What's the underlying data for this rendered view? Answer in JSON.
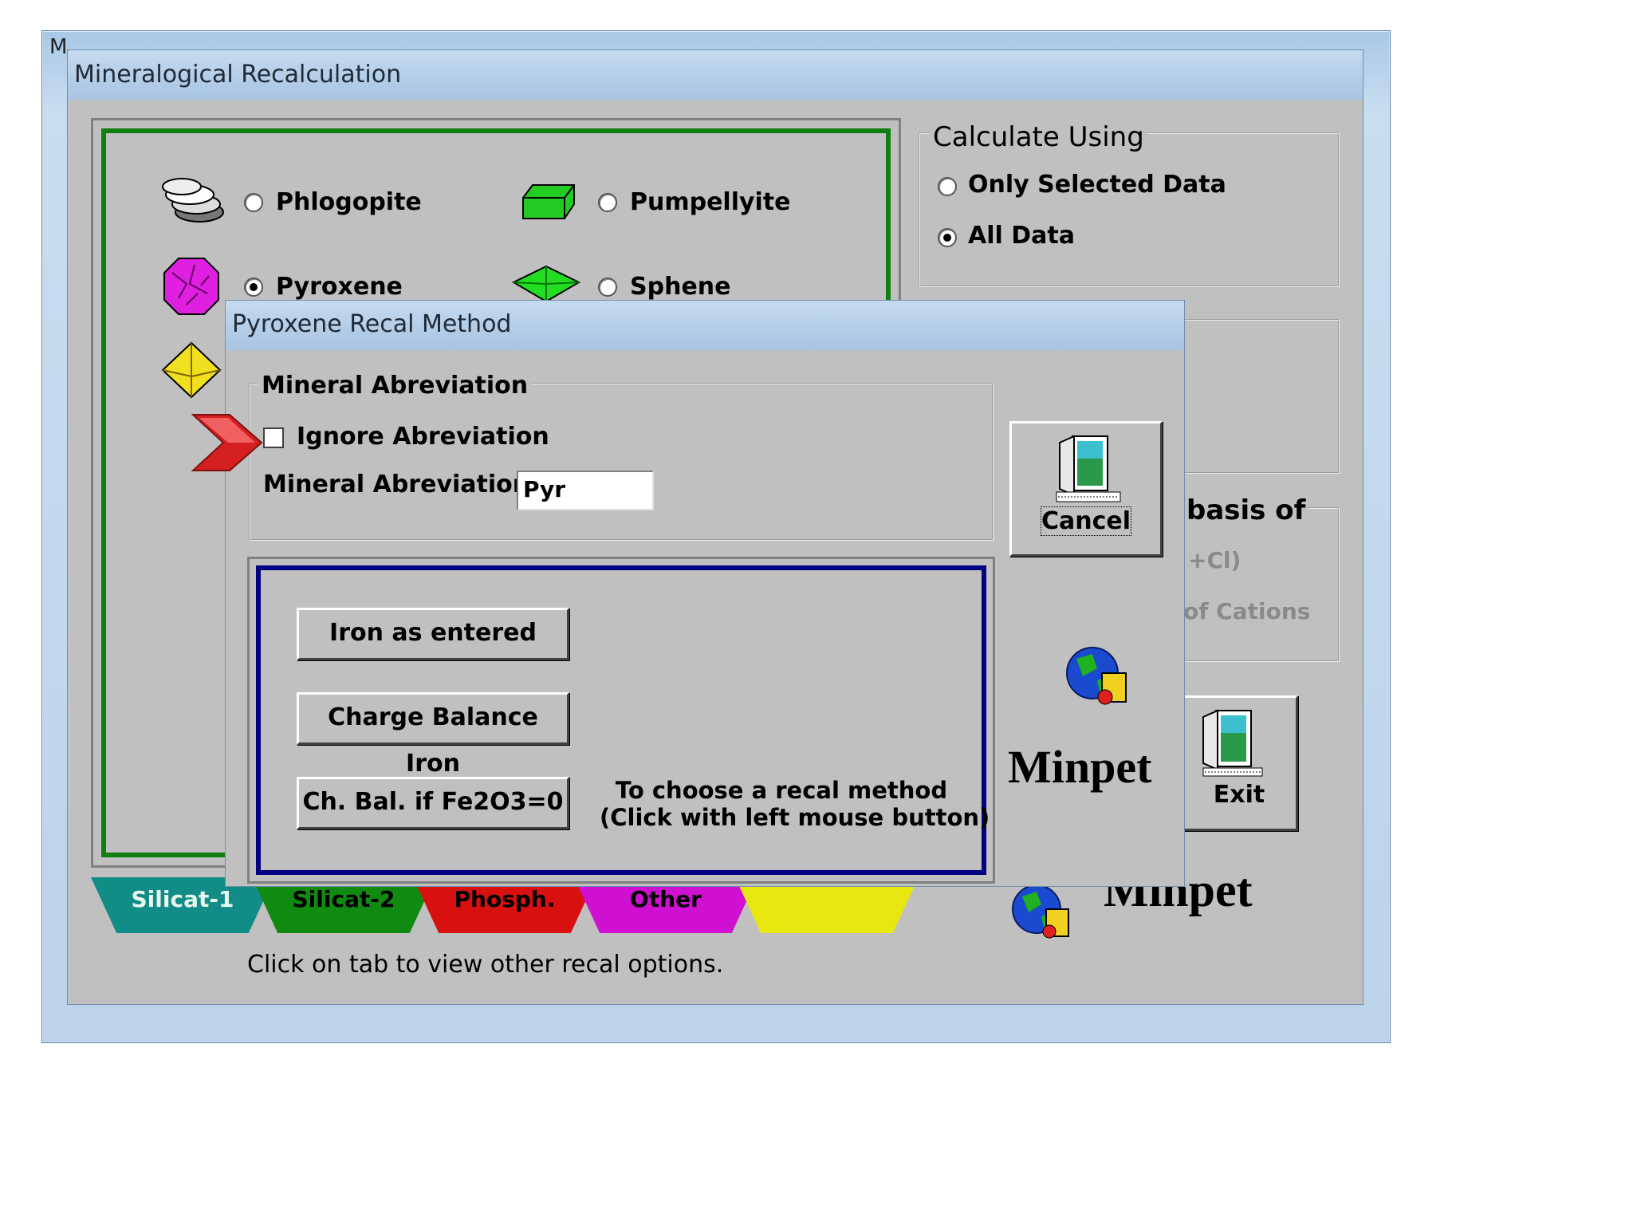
{
  "outer_window": {
    "ghost_title": "M"
  },
  "main_dialog": {
    "title": "Mineralogical Recalculation",
    "minerals": [
      {
        "label": "Phlogopite",
        "selected": false
      },
      {
        "label": "Pumpellyite",
        "selected": false
      },
      {
        "label": "Pyroxene",
        "selected": true
      },
      {
        "label": "Sphene",
        "selected": false
      }
    ],
    "calculate_using": {
      "title": "Calculate Using",
      "options": [
        {
          "label": "Only Selected Data",
          "selected": false
        },
        {
          "label": "All Data",
          "selected": true
        }
      ]
    },
    "basis_group": {
      "title_fragment": "basis of",
      "option1_fragment": "+Cl)",
      "option2_fragment": "of Cations"
    },
    "exit_label": "Exit",
    "logo_text": "Minpet",
    "tabs": [
      {
        "label": "Silicat-1",
        "color": "#128c86"
      },
      {
        "label": "Silicat-2",
        "color": "#108a10"
      },
      {
        "label": "Phosph.",
        "color": "#d81010"
      },
      {
        "label": "Other",
        "color": "#d010d0"
      },
      {
        "label": "",
        "color": "#e8e810"
      }
    ],
    "tab_hint": "Click on tab to view other recal options."
  },
  "pyroxene_dialog": {
    "title": "Pyroxene Recal Method",
    "abbrev_group_title": "Mineral Abreviation",
    "ignore_label": "Ignore Abreviation",
    "ignore_checked": false,
    "abbrev_label": "Mineral Abreviation",
    "abbrev_value": "Pyr",
    "buttons": {
      "iron_as_entered": "Iron as entered",
      "charge_balance_iron": "Charge Balance Iron",
      "ch_bal_if": "Ch. Bal. if Fe2O3=0"
    },
    "instructions_line1": "To choose a recal method",
    "instructions_line2": "(Click with left mouse button)",
    "cancel_label": "Cancel",
    "logo_text": "Minpet"
  },
  "colors": {
    "dialog_bg": "#c0c0c0",
    "title_bar": "#b6cfe8",
    "frame_green": "#108010",
    "frame_navy": "#000080",
    "pointer_red": "#d42020"
  }
}
